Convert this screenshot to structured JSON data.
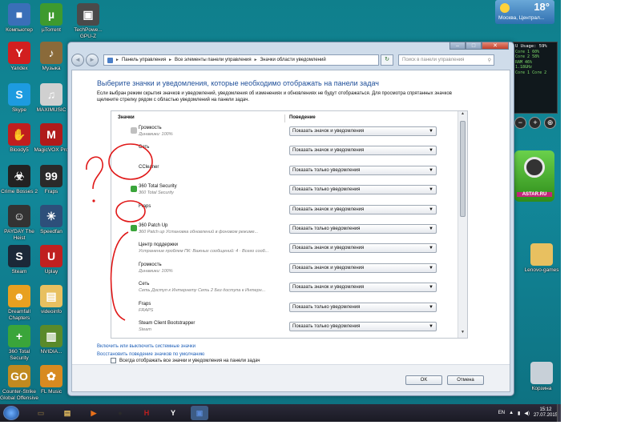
{
  "desktop": {
    "icons": [
      {
        "label": "Компьютер",
        "color": "#3a6fb8",
        "glyph": "■"
      },
      {
        "label": "µTorrent",
        "color": "#3e9a2e",
        "glyph": "µ"
      },
      {
        "label": "TechPowe... GPU-Z",
        "color": "#4a4a4a",
        "glyph": "▣"
      },
      {
        "label": "Yandex",
        "color": "#d21f1f",
        "glyph": "Y"
      },
      {
        "label": "Музыка",
        "color": "#8a6a3a",
        "glyph": "♪"
      },
      {
        "label": "Skype",
        "color": "#1d9be0",
        "glyph": "S"
      },
      {
        "label": "MAXIMUSIC",
        "color": "#d0d0d0",
        "glyph": "♫"
      },
      {
        "label": "Bloody5",
        "color": "#c01e1e",
        "glyph": "✋"
      },
      {
        "label": "MagicVOX Pro",
        "color": "#b01a1a",
        "glyph": "M"
      },
      {
        "label": "Crime Bosses 2",
        "color": "#222222",
        "glyph": "☣"
      },
      {
        "label": "Fraps",
        "color": "#2a2a2a",
        "glyph": "99"
      },
      {
        "label": "PAYDAY The Heist",
        "color": "#333333",
        "glyph": "☺"
      },
      {
        "label": "Speedfan",
        "color": "#2d4f7a",
        "glyph": "✳"
      },
      {
        "label": "Steam",
        "color": "#1b2838",
        "glyph": "S"
      },
      {
        "label": "Uplay",
        "color": "#c02020",
        "glyph": "U"
      },
      {
        "label": "Dreamfall Chapters",
        "color": "#e8a020",
        "glyph": "☻"
      },
      {
        "label": "videoinfo",
        "color": "#e8c060",
        "glyph": "▤"
      },
      {
        "label": "360 Total Security",
        "color": "#3aa53a",
        "glyph": "+"
      },
      {
        "label": "NVIDIA...",
        "color": "#5a8a2a",
        "glyph": "▥"
      },
      {
        "label": "Counter-Strike Global Offensive",
        "color": "#c08a20",
        "glyph": "GO"
      },
      {
        "label": "FL Music",
        "color": "#d88a20",
        "glyph": "✿"
      }
    ],
    "right_icons": [
      {
        "label": "Lenovo-games",
        "color": "#e8c060"
      },
      {
        "label": "Корзина",
        "color": "#c8d0d8"
      }
    ],
    "weather": {
      "temp": "18°",
      "city": "Москва, Централ..."
    },
    "cpu_gadget": {
      "title": "U Usage: 59%",
      "lines": [
        "Core 1  60%",
        "Core 2  58%",
        "RAM 46%",
        "1.18GHz",
        "Core 1 Core 2"
      ]
    },
    "gadget_buttons": [
      "−",
      "+",
      "⊕"
    ],
    "badge_brand": "ASTAR.RU"
  },
  "window": {
    "nav": {
      "back": "◄",
      "forward": "►",
      "breadcrumbs": [
        "Панель управления",
        "Все элементы панели управления",
        "Значки области уведомлений"
      ],
      "search_placeholder": "Поиск в панели управления",
      "refresh": "↻"
    },
    "controls": {
      "min": "–",
      "max": "□",
      "close": "✕"
    },
    "heading": "Выберите значки и уведомления, которые необходимо отображать на панели задач",
    "description": "Если выбран режим скрытия значков и уведомлений, уведомления об изменениях и обновлениях не будут отображаться. Для просмотра спрятанных значков щелкните стрелку рядом с областью уведомлений на панели задач.",
    "columns": {
      "icons": "Значки",
      "behavior": "Поведение"
    },
    "rows": [
      {
        "name": "Громкость",
        "sub": "Динамики: 100%",
        "behavior": "Показать значок и уведомления",
        "icon_color": "#c0c0c0"
      },
      {
        "name": "Сеть",
        "sub": "",
        "behavior": "Показать значок и уведомления",
        "icon_color": ""
      },
      {
        "name": "CCleaner",
        "sub": "",
        "behavior": "Показать только уведомления",
        "icon_color": ""
      },
      {
        "name": "360 Total Security",
        "sub": "360 Total Security",
        "behavior": "Показать только уведомления",
        "icon_color": "#3aa53a"
      },
      {
        "name": "Fraps",
        "sub": "",
        "behavior": "Показать значок и уведомления",
        "icon_color": ""
      },
      {
        "name": "360 Patch Up",
        "sub": "360 Patch up Установка обновлений в фоновом режиме...",
        "behavior": "Показать только уведомления",
        "icon_color": "#3aa53a"
      },
      {
        "name": "Центр поддержки",
        "sub": "Устранение проблем ПК: Важных сообщений: 4 · Всего сооб...",
        "behavior": "Показать значок и уведомления",
        "icon_color": ""
      },
      {
        "name": "Громкость",
        "sub": "Динамики: 100%",
        "behavior": "Показать значок и уведомления",
        "icon_color": ""
      },
      {
        "name": "Сеть",
        "sub": "Сеть Доступ к Интернету Сеть 2 Без доступа к Интерн...",
        "behavior": "Показать значок и уведомления",
        "icon_color": ""
      },
      {
        "name": "Fraps",
        "sub": "FRAPS",
        "behavior": "Показать только уведомления",
        "icon_color": ""
      },
      {
        "name": "Steam Client Bootstrapper",
        "sub": "Steam",
        "behavior": "Показать только уведомления",
        "icon_color": ""
      }
    ],
    "links": {
      "system_icons": "Включить или выключить системные значки",
      "restore_default": "Восстановить поведение значков по умолчанию"
    },
    "always_show": "Всегда отображать все значки и уведомления на панели задач",
    "buttons": {
      "ok": "OK",
      "cancel": "Отмена"
    }
  },
  "taskbar": {
    "items": [
      {
        "glyph": "▭",
        "color": "#6a5a3a"
      },
      {
        "glyph": "▤",
        "color": "#e8c060"
      },
      {
        "glyph": "▶",
        "color": "#e8701a"
      },
      {
        "glyph": "●",
        "color": "#2a2a2a"
      },
      {
        "glyph": "H",
        "color": "#c01e1e"
      },
      {
        "glyph": "Y",
        "color": "#ffffff"
      },
      {
        "glyph": "▣",
        "color": "#5a8ad8"
      }
    ],
    "lang": "EN",
    "time": "15:12",
    "date": "27.07.2015"
  }
}
